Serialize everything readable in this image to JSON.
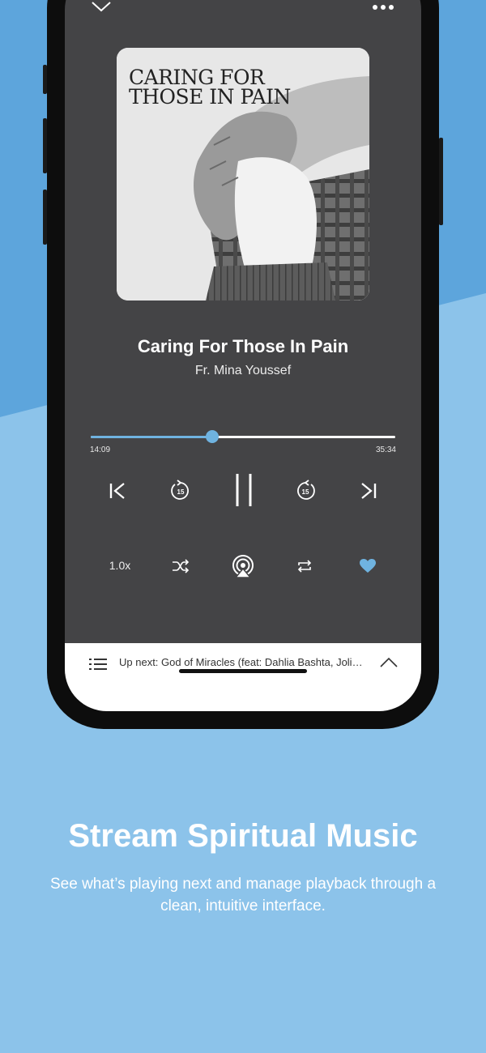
{
  "colors": {
    "accent": "#6fb3e0",
    "background": "#7ab7e4",
    "player_bg": "#444446"
  },
  "player": {
    "artwork_text_line1": "CARING FOR",
    "artwork_text_line2": "THOSE IN PAIN",
    "title": "Caring For Those In Pain",
    "artist": "Fr. Mina Youssef",
    "elapsed": "14:09",
    "duration": "35:34",
    "progress": 0.4,
    "skip_back_seconds": "15",
    "skip_forward_seconds": "15",
    "speed": "1.0x",
    "liked": true
  },
  "icons": [
    "chevron-down-icon",
    "more-icon",
    "skip-previous-icon",
    "rewind-15-icon",
    "pause-icon",
    "forward-15-icon",
    "skip-next-icon",
    "shuffle-icon",
    "airplay-icon",
    "repeat-icon",
    "heart-icon",
    "queue-list-icon",
    "chevron-up-icon"
  ],
  "up_next": {
    "text": "Up next: God of Miracles (feat: Dahlia Bashta, Joli…"
  },
  "promo": {
    "headline": "Stream Spiritual Music",
    "description": "See what’s playing next and manage playback through a clean, intuitive interface."
  }
}
